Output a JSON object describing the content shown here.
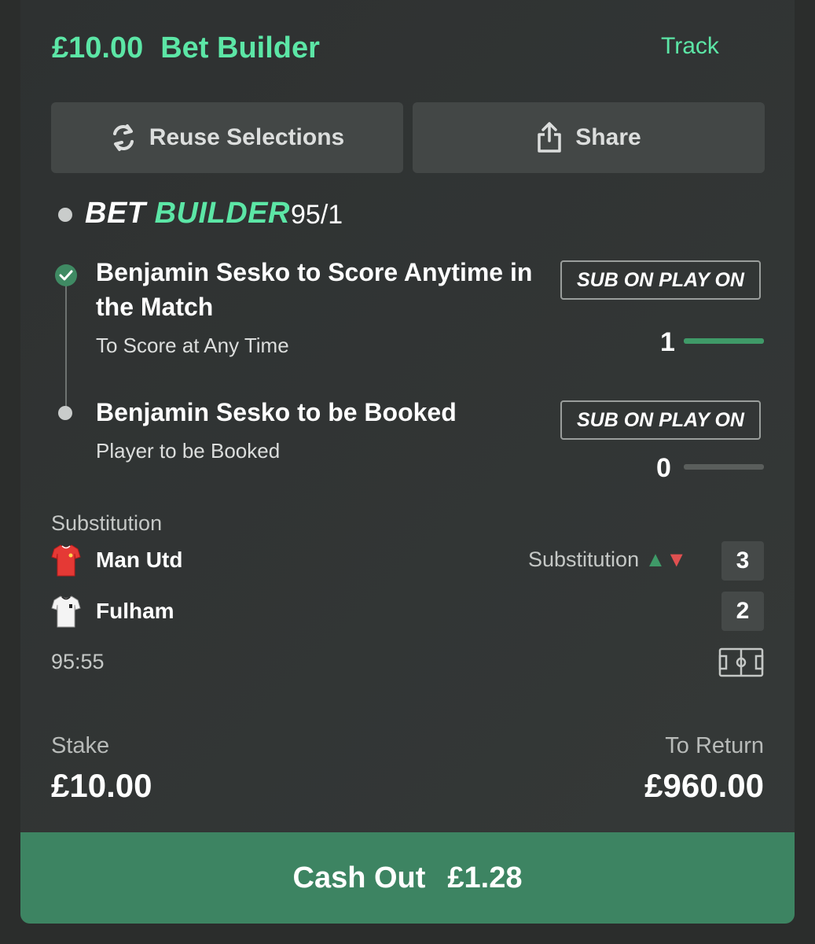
{
  "header": {
    "stake_amount": "£10.00",
    "bet_type": "Bet Builder",
    "track_label": "Track"
  },
  "actions": {
    "reuse_label": "Reuse Selections",
    "share_label": "Share"
  },
  "bet_builder": {
    "title_part1": "BET",
    "title_part2": "BUILDER",
    "odds": "95/1",
    "legs": [
      {
        "title": "Benjamin Sesko to Score Anytime in the Match",
        "subtitle": "To Score at Any Time",
        "status": "won",
        "button_label": "SUB ON PLAY ON",
        "progress_value": "1",
        "progress_fraction": 1
      },
      {
        "title": "Benjamin Sesko to be Booked",
        "subtitle": "Player to be Booked",
        "status": "pending",
        "button_label": "SUB ON PLAY ON",
        "progress_value": "0",
        "progress_fraction": 0
      }
    ]
  },
  "match": {
    "event_label": "Substitution",
    "event_right_label": "Substitution",
    "teams": [
      {
        "name": "Man Utd",
        "score": "3",
        "shirt_color": "#e53935"
      },
      {
        "name": "Fulham",
        "score": "2",
        "shirt_color": "#f4f4f4"
      }
    ],
    "clock": "95:55"
  },
  "summary": {
    "stake_label": "Stake",
    "stake_value": "£10.00",
    "return_label": "To Return",
    "return_value": "£960.00"
  },
  "cashout": {
    "label": "Cash Out",
    "amount": "£1.28"
  },
  "colors": {
    "accent_green": "#5ce6a6",
    "cashout_green": "#3d8462",
    "card_bg": "#323535"
  }
}
